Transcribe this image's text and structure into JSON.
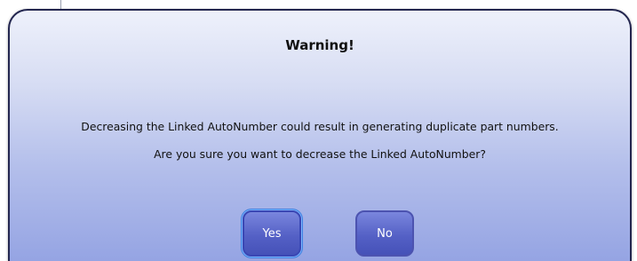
{
  "dialog": {
    "title": "Warning!",
    "message_line1": "Decreasing the Linked AutoNumber could result in generating duplicate part numbers.",
    "message_line2": "Are you sure you want to decrease the Linked AutoNumber?",
    "buttons": {
      "yes_label": "Yes",
      "no_label": "No"
    }
  },
  "colors": {
    "dialog_border": "#23264f",
    "dialog_gradient_top": "#eef1fb",
    "dialog_gradient_bottom": "#95a4e3",
    "button_fill": "#5561c6",
    "button_text": "#ffffff",
    "focus_ring": "#3f7fe0"
  }
}
